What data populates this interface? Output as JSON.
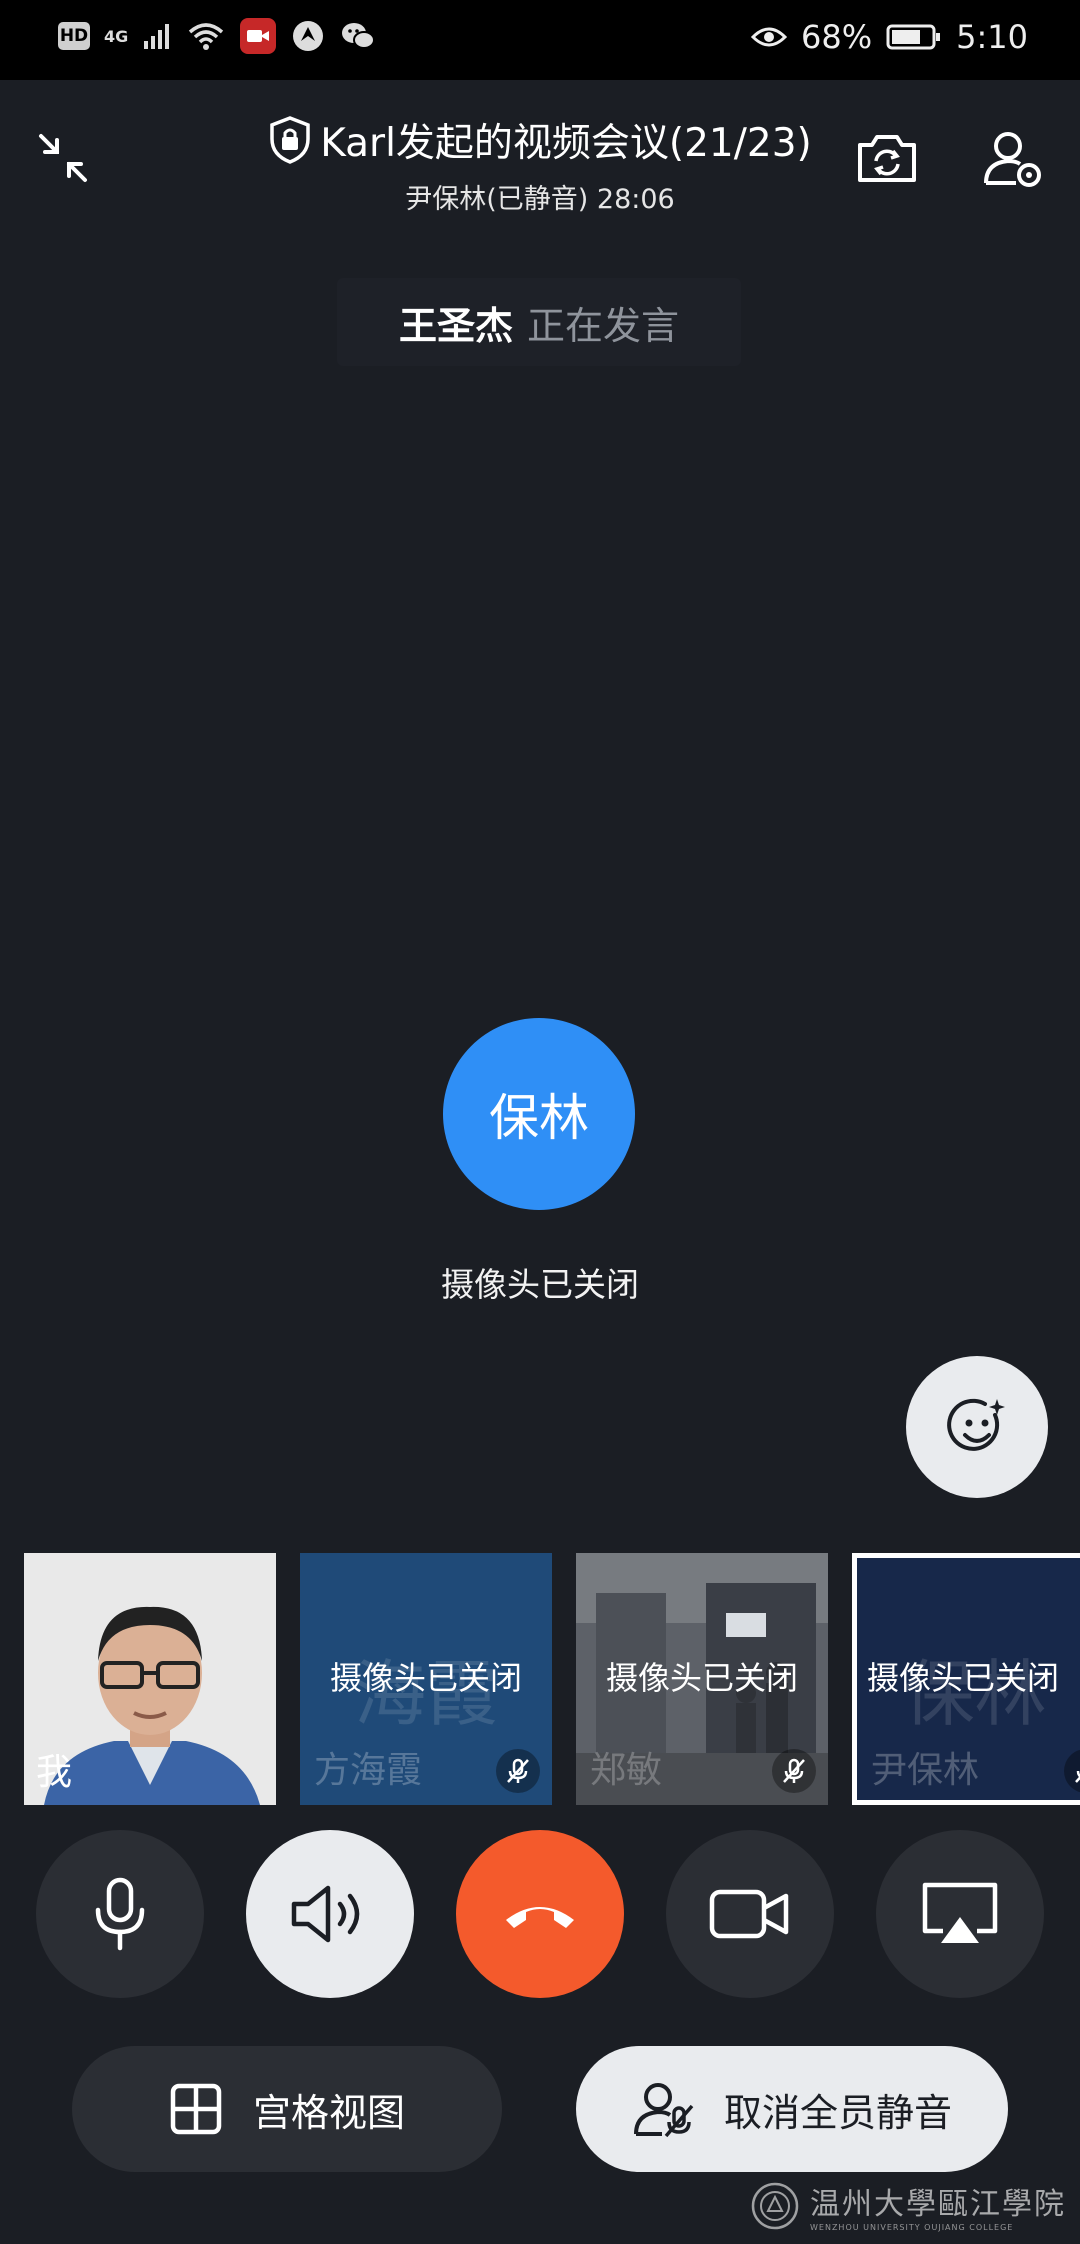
{
  "status_bar": {
    "hd": "HD",
    "network": "4G",
    "battery": "68%",
    "time": "5:10"
  },
  "meeting": {
    "title": "Karl发起的视频会议(21/23)",
    "subtitle": "尹保林(已静音) 28:06"
  },
  "speaker": {
    "name": "王圣杰",
    "status": "正在发言"
  },
  "main_view": {
    "avatar_text": "保林",
    "camera_status": "摄像头已关闭",
    "avatar_color": "#2f8ff6"
  },
  "thumbnails": [
    {
      "label": "我",
      "type": "photo"
    },
    {
      "watermark": "海霞",
      "caption": "摄像头已关闭",
      "name": "方海霞",
      "muted": true
    },
    {
      "caption": "摄像头已关闭",
      "name": "郑敏",
      "muted": true
    },
    {
      "watermark": "保林",
      "caption": "摄像头已关闭",
      "name": "尹保林",
      "muted": true,
      "selected": true
    }
  ],
  "controls": {
    "mic": "microphone-icon",
    "speaker": "speaker-icon",
    "hangup": "hang-up-icon",
    "camera": "video-camera-icon",
    "share": "screen-share-icon",
    "hangup_color": "#f45a2c"
  },
  "actions": {
    "grid_view": "宫格视图",
    "unmute_all": "取消全员静音"
  },
  "watermark": {
    "text": "温州大學甌江學院",
    "sub": "WENZHOU UNIVERSITY OUJIANG COLLEGE"
  }
}
